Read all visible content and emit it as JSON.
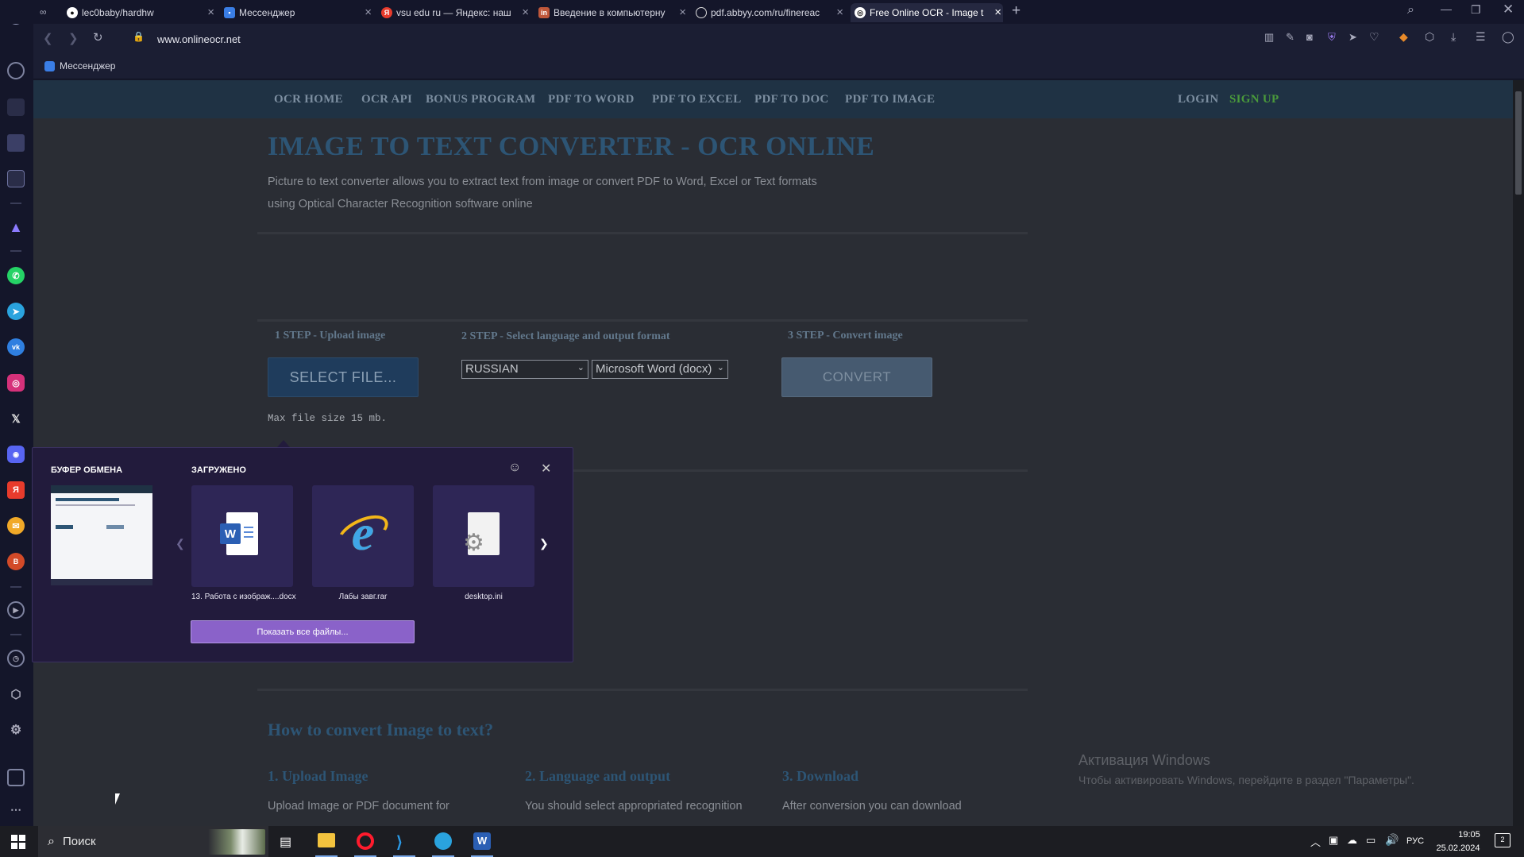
{
  "browser": {
    "tabs": [
      {
        "label": "lec0baby/hardhw",
        "icon": "github-icon"
      },
      {
        "label": "Мессенджер",
        "icon": "messenger-icon"
      },
      {
        "label": "vsu edu ru — Яндекс: наш",
        "icon": "yandex-icon"
      },
      {
        "label": "Введение в компьютерну",
        "icon": "tab-icon"
      },
      {
        "label": "pdf.abbyy.com/ru/finereac",
        "icon": "globe-icon"
      },
      {
        "label": "Free Online OCR - Image t",
        "icon": "ocr-icon"
      }
    ],
    "url": "www.onlineocr.net",
    "bookmark": "Мессенджер"
  },
  "site": {
    "nav": [
      "OCR HOME",
      "OCR API",
      "BONUS PROGRAM",
      "PDF TO WORD",
      "PDF TO EXCEL",
      "PDF TO DOC",
      "PDF TO IMAGE"
    ],
    "login": "LOGIN",
    "signup": "SIGN UP",
    "title": "IMAGE TO TEXT CONVERTER - OCR ONLINE",
    "desc_line1": "Picture to text converter allows you to extract text from image or convert PDF to Word, Excel or Text formats",
    "desc_line2": "using Optical Character Recognition software online",
    "step1": "1 STEP - Upload image",
    "step2": "2 STEP - Select language and output format",
    "step3": "3 STEP - Convert image",
    "select_file": "SELECT FILE...",
    "language": "RUSSIAN",
    "format": "Microsoft Word (docx)",
    "convert": "CONVERT",
    "max_size": "Max file size 15 mb.",
    "how_title": "How to convert Image to text?",
    "how": [
      {
        "title": "1. Upload Image",
        "text": "Upload Image or PDF document for"
      },
      {
        "title": "2. Language and output",
        "text": "You should select appropriated recognition"
      },
      {
        "title": "3. Download",
        "text": "After conversion you can download"
      }
    ]
  },
  "popup": {
    "clipboard_title": "БУФЕР ОБМЕНА",
    "downloads_title": "ЗАГРУЖЕНО",
    "files": [
      {
        "name": "13. Работа с изображ....docx",
        "icon": "word-file-icon"
      },
      {
        "name": "Лабы завг.rar",
        "icon": "internet-explorer-icon"
      },
      {
        "name": "desktop.ini",
        "icon": "settings-file-icon"
      }
    ],
    "show_all": "Показать все файлы..."
  },
  "watermark": {
    "title": "Активация Windows",
    "text": "Чтобы активировать Windows, перейдите в раздел \"Параметры\"."
  },
  "taskbar": {
    "search": "Поиск",
    "lang": "РУС",
    "time": "19:05",
    "date": "25.02.2024",
    "notif_count": "2"
  },
  "colors": {
    "nav_bg": "#1f3244",
    "signup": "#4a9a3b",
    "title": "#2d5575",
    "popup_bg": "#221b3c",
    "show_all_btn": "#8a62c9"
  }
}
